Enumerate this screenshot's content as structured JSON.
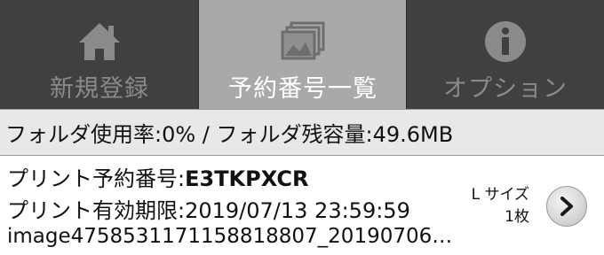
{
  "tabs": [
    {
      "label": "新規登録",
      "icon": "home-icon",
      "selected": false
    },
    {
      "label": "予約番号一覧",
      "icon": "images-icon",
      "selected": true
    },
    {
      "label": "オプション",
      "icon": "info-icon",
      "selected": false
    }
  ],
  "status": {
    "text": "フォルダ使用率:0% / フォルダ残容量:49.6MB"
  },
  "reservation": {
    "number_label": "プリント予約番号:",
    "number_value": "E3TKPXCR",
    "expiry_label": "プリント有効期限:",
    "expiry_value": "2019/07/13 23:59:59",
    "filename": "image4758531171158818807_20190706…",
    "size": "L サイズ",
    "count": "1枚",
    "detail_icon": "chevron-right-icon"
  },
  "colors": {
    "tabbar_bg": "#404040",
    "tab_selected_bg": "#a9a9a9",
    "tab_inactive_text": "#8a8a8a",
    "status_bg": "#e8e8e8"
  }
}
